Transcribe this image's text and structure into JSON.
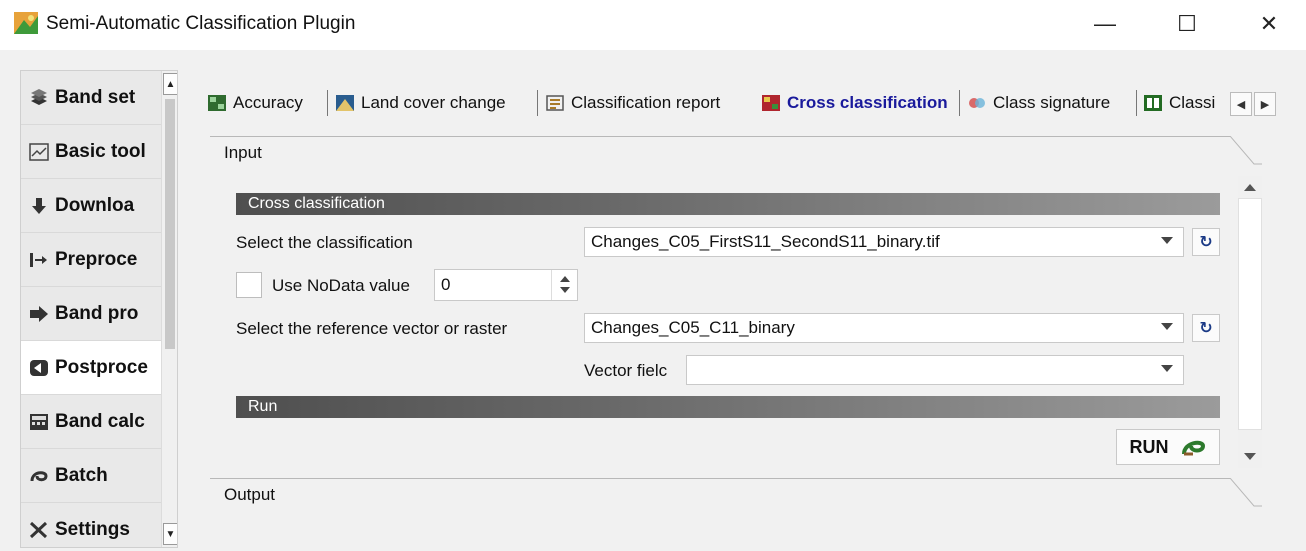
{
  "window": {
    "title": "Semi-Automatic Classification Plugin",
    "minimize": "—",
    "maximize": "☐",
    "close": "✕"
  },
  "sidebar": {
    "items": [
      {
        "label": "Band set",
        "icon": "band-set-icon"
      },
      {
        "label": "Basic tool",
        "icon": "basic-tools-icon"
      },
      {
        "label": "Downloa",
        "icon": "download-icon"
      },
      {
        "label": "Preproce",
        "icon": "preprocessing-icon"
      },
      {
        "label": "Band pro",
        "icon": "band-processing-icon"
      },
      {
        "label": "Postproce",
        "icon": "postprocessing-icon"
      },
      {
        "label": "Band calc",
        "icon": "band-calc-icon"
      },
      {
        "label": "Batch",
        "icon": "batch-icon"
      },
      {
        "label": "Settings",
        "icon": "settings-icon"
      }
    ],
    "active_index": 5
  },
  "tabs": {
    "items": [
      {
        "label": "Accuracy"
      },
      {
        "label": "Land cover change"
      },
      {
        "label": "Classification report"
      },
      {
        "label": "Cross classification"
      },
      {
        "label": "Class signature"
      },
      {
        "label": "Classi"
      }
    ],
    "active_index": 3
  },
  "panel": {
    "input_label": "Input",
    "output_label": "Output",
    "cross_header": "Cross classification",
    "select_classification_label": "Select the classification",
    "classification_value": "Changes_C05_FirstS11_SecondS11_binary.tif",
    "use_nodata_label": "Use NoData value",
    "nodata_value": "0",
    "select_reference_label": "Select the reference vector or raster",
    "reference_value": "Changes_C05_C11_binary",
    "vector_field_label": "Vector fielc",
    "vector_field_value": "",
    "run_header": "Run",
    "run_button": "RUN",
    "refresh_glyph": "↻"
  },
  "colors": {
    "active_tab_text": "#1a1a9c",
    "header_gradient_start": "#4f4f4f",
    "header_gradient_end": "#9b9b9b"
  }
}
